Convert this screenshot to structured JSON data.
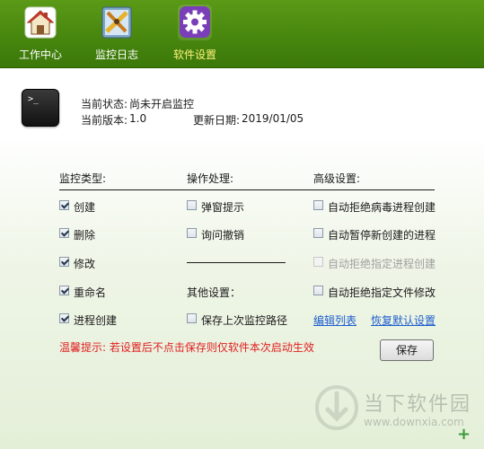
{
  "toolbar": {
    "items": [
      {
        "label": "工作中心",
        "icon": "house-icon"
      },
      {
        "label": "监控日志",
        "icon": "ruler-icon"
      },
      {
        "label": "软件设置",
        "icon": "gear-icon",
        "active": true
      }
    ]
  },
  "status": {
    "state_label": "当前状态:",
    "state_value": "尚未开启监控",
    "version_label": "当前版本:",
    "version_value": "1.0",
    "update_label": "更新日期:",
    "update_value": "2019/01/05"
  },
  "headers": {
    "monitor_type": "监控类型:",
    "operation": "操作处理:",
    "advanced": "高级设置:"
  },
  "monitor_types": [
    {
      "label": "创建",
      "checked": true
    },
    {
      "label": "删除",
      "checked": true
    },
    {
      "label": "修改",
      "checked": true
    },
    {
      "label": "重命名",
      "checked": true
    },
    {
      "label": "进程创建",
      "checked": true
    }
  ],
  "operations": [
    {
      "label": "弹窗提示",
      "checked": false
    },
    {
      "label": "询问撤销",
      "checked": false
    }
  ],
  "other_settings_label": "其他设置：",
  "save_path": {
    "label": "保存上次监控路径",
    "checked": false
  },
  "advanced": [
    {
      "label": "自动拒绝病毒进程创建",
      "checked": false,
      "disabled": false
    },
    {
      "label": "自动暂停新创建的进程",
      "checked": false,
      "disabled": false
    },
    {
      "label": "自动拒绝指定进程创建",
      "checked": false,
      "disabled": true
    },
    {
      "label": "自动拒绝指定文件修改",
      "checked": false,
      "disabled": false
    }
  ],
  "links": {
    "edit_list": "编辑列表",
    "restore_default": "恢复默认设置"
  },
  "warning": "温馨提示: 若设置后不点击保存则仅软件本次启动生效",
  "save_button": "保存",
  "watermark": {
    "title": "当下软件园",
    "url": "www.downxia.com"
  },
  "colors": {
    "toolbar": "#4b8a10",
    "active_label": "#fff37a",
    "warning": "#e02020",
    "link": "#1f5fd0"
  }
}
